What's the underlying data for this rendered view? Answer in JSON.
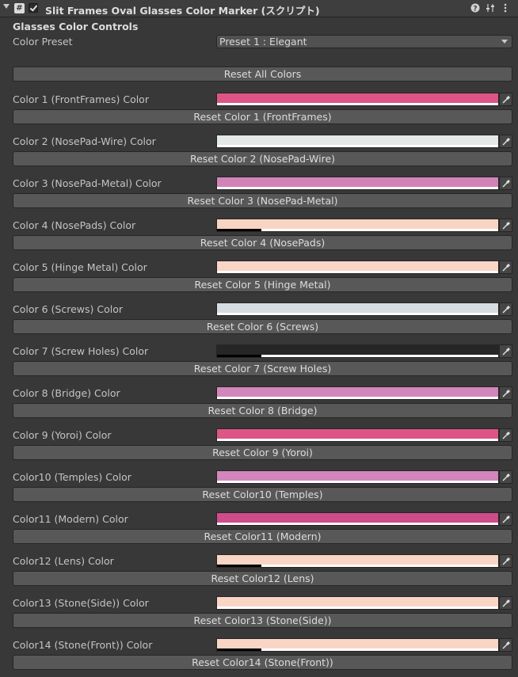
{
  "header": {
    "title": "Slit Frames Oval Glasses Color Marker (スクリプト)",
    "script_icon_glyph": "#",
    "icons": [
      "help-icon",
      "preset-icon",
      "more-menu-icon"
    ]
  },
  "section_title": "Glasses Color Controls",
  "preset": {
    "label": "Color Preset",
    "value": "Preset 1 : Elegant"
  },
  "reset_all_label": "Reset All Colors",
  "colors": [
    {
      "label": "Color 1 (FrontFrames) Color",
      "button": "Reset Color 1 (FrontFrames)",
      "color": "#dc5586",
      "alpha_full": true
    },
    {
      "label": "Color 2 (NosePad-Wire) Color",
      "button": "Reset Color 2 (NosePad-Wire)",
      "color": "#e4e8e6",
      "alpha_full": true
    },
    {
      "label": "Color 3 (NosePad-Metal) Color",
      "button": "Reset Color 3 (NosePad-Metal)",
      "color": "#d183b8",
      "alpha_full": true
    },
    {
      "label": "Color 4 (NosePads) Color",
      "button": "Reset Color 4 (NosePads)",
      "color": "#f8d4c3",
      "alpha_full": false
    },
    {
      "label": "Color 5 (Hinge Metal) Color",
      "button": "Reset Color 5 (Hinge Metal)",
      "color": "#f9d5c6",
      "alpha_full": true
    },
    {
      "label": "Color 6 (Screws) Color",
      "button": "Reset Color 6 (Screws)",
      "color": "#d7dce0",
      "alpha_full": true
    },
    {
      "label": "Color 7 (Screw Holes) Color",
      "button": "Reset Color 7 (Screw Holes)",
      "color": "#262626",
      "alpha_full": false
    },
    {
      "label": "Color 8 (Bridge) Color",
      "button": "Reset Color 8 (Bridge)",
      "color": "#d286bb",
      "alpha_full": true
    },
    {
      "label": "Color 9 (Yoroi) Color",
      "button": "Reset Color 9 (Yoroi)",
      "color": "#dc5586",
      "alpha_full": true
    },
    {
      "label": "Color10 (Temples) Color",
      "button": "Reset Color10 (Temples)",
      "color": "#d286bb",
      "alpha_full": true
    },
    {
      "label": "Color11 (Modern) Color",
      "button": "Reset Color11 (Modern)",
      "color": "#cf4c8a",
      "alpha_full": true
    },
    {
      "label": "Color12 (Lens) Color",
      "button": "Reset Color12 (Lens)",
      "color": "#f9d5c6",
      "alpha_full": false
    },
    {
      "label": "Color13 (Stone(Side)) Color",
      "button": "Reset Color13 (Stone(Side))",
      "color": "#f9d5c6",
      "alpha_full": true
    },
    {
      "label": "Color14 (Stone(Front)) Color",
      "button": "Reset Color14 (Stone(Front))",
      "color": "#f9d5c6",
      "alpha_full": false
    }
  ]
}
